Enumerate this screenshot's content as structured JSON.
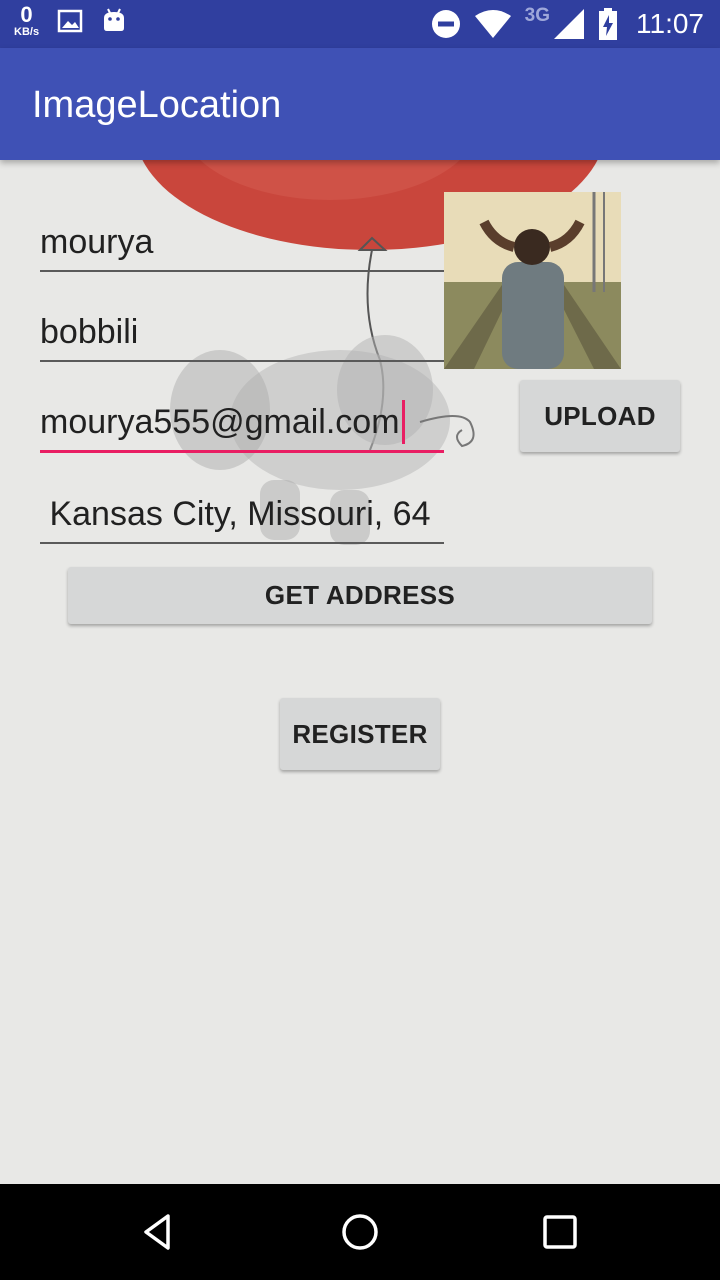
{
  "status_bar": {
    "data_rate_value": "0",
    "data_rate_unit": "KB/s",
    "network_type": "3G",
    "time": "11:07",
    "icons": [
      "gallery-icon",
      "android-icon",
      "do-not-disturb-icon",
      "wifi-icon",
      "signal-icon",
      "battery-charging-icon"
    ]
  },
  "app_bar": {
    "title": "ImageLocation"
  },
  "form": {
    "name_value": "mourya",
    "city_value": "bobbili",
    "email_value": "mourya555@gmail.com",
    "address_value": " Kansas City, Missouri, 64"
  },
  "buttons": {
    "upload": "UPLOAD",
    "get_address": "GET ADDRESS",
    "register": "REGISTER"
  },
  "colors": {
    "status_bar": "#303f9f",
    "app_bar": "#3f51b5",
    "accent": "#e91e63",
    "background": "#e8e8e6"
  },
  "nav_bar": {
    "icons": [
      "back-icon",
      "home-icon",
      "recents-icon"
    ]
  }
}
